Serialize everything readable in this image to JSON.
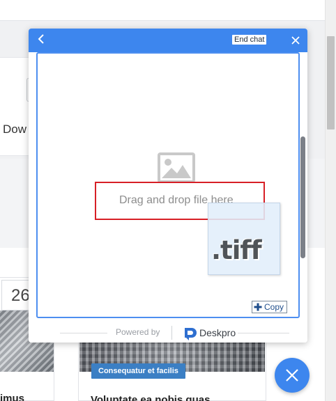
{
  "background": {
    "card_partial_text": "Dow",
    "date_partial_text": "26",
    "tag_label": "Consequatur et facilis",
    "left_title_partial": "imus",
    "right_title_partial": "Voluptate ea nobis quas"
  },
  "chat": {
    "header": {
      "back_icon": "chevron-left-icon",
      "end_chat_label": "End chat",
      "close_icon": "close-icon",
      "color": "#3d86ee"
    },
    "drop_zone": {
      "icon": "image-placeholder-icon",
      "text": "Drag and drop file here",
      "border_color": "#4d8ef0",
      "highlight_color": "#d71f26"
    },
    "drag_preview": {
      "file_label": ".tiff",
      "copy_label": "Copy",
      "copy_icon": "plus-icon"
    },
    "footer": {
      "powered_by": "Powered by",
      "brand": "Deskpro",
      "brand_icon": "deskpro-logo-icon"
    }
  },
  "fab": {
    "icon": "close-icon"
  }
}
